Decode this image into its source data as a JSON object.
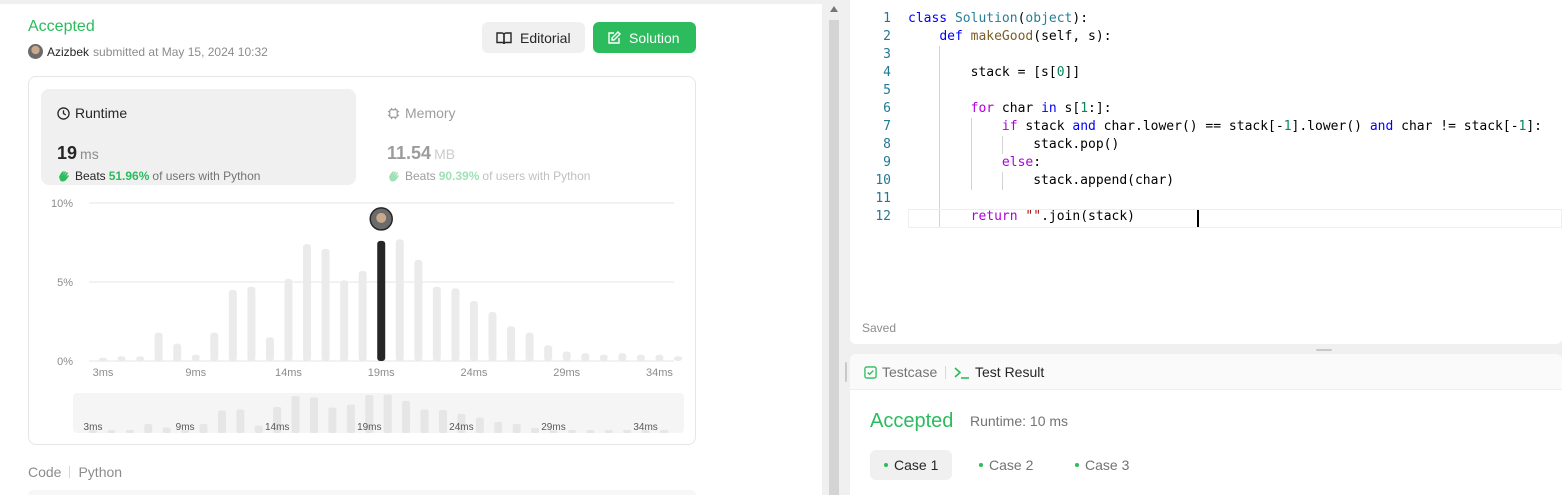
{
  "submission": {
    "status": "Accepted",
    "user": "Azizbek",
    "submitted_text": "submitted at May 15, 2024 10:32",
    "editorial_label": "Editorial",
    "solution_label": "Solution"
  },
  "runtime": {
    "label": "Runtime",
    "value": "19",
    "unit": "ms",
    "beats_prefix": "Beats",
    "beats_pct": "51.96%",
    "beats_suffix": "of users with Python"
  },
  "memory": {
    "label": "Memory",
    "value": "11.54",
    "unit": "MB",
    "beats_prefix": "Beats",
    "beats_pct": "90.39%",
    "beats_suffix": "of users with Python"
  },
  "chart_data": {
    "type": "bar",
    "y_ticks": [
      "10%",
      "5%",
      "0%"
    ],
    "ylim": [
      0,
      10
    ],
    "x_tick_labels": [
      "3ms",
      "9ms",
      "14ms",
      "19ms",
      "24ms",
      "29ms",
      "34ms"
    ],
    "x_tick_indices": [
      0,
      5,
      10,
      15,
      20,
      25,
      30
    ],
    "values": [
      0.2,
      0.3,
      0.3,
      1.8,
      1.1,
      0.4,
      1.8,
      4.5,
      4.7,
      1.5,
      5.2,
      7.4,
      7.1,
      5.1,
      5.7,
      7.6,
      7.7,
      6.4,
      4.7,
      4.6,
      3.8,
      3.1,
      2.2,
      1.8,
      1.0,
      0.6,
      0.5,
      0.4,
      0.5,
      0.4,
      0.4,
      0.3
    ],
    "highlight_index": 15,
    "colors": {
      "bar": "#ebebeb",
      "highlight": "#262626",
      "grid": "#e6e6e6"
    }
  },
  "code_section": {
    "label": "Code",
    "language": "Python"
  },
  "editor": {
    "line_numbers": [
      "1",
      "2",
      "3",
      "4",
      "5",
      "6",
      "7",
      "8",
      "9",
      "10",
      "11",
      "12"
    ],
    "saved_label": "Saved"
  },
  "tests": {
    "tab_testcase": "Testcase",
    "tab_result": "Test Result",
    "status": "Accepted",
    "runtime": "Runtime: 10 ms",
    "cases": [
      "Case 1",
      "Case 2",
      "Case 3"
    ]
  }
}
